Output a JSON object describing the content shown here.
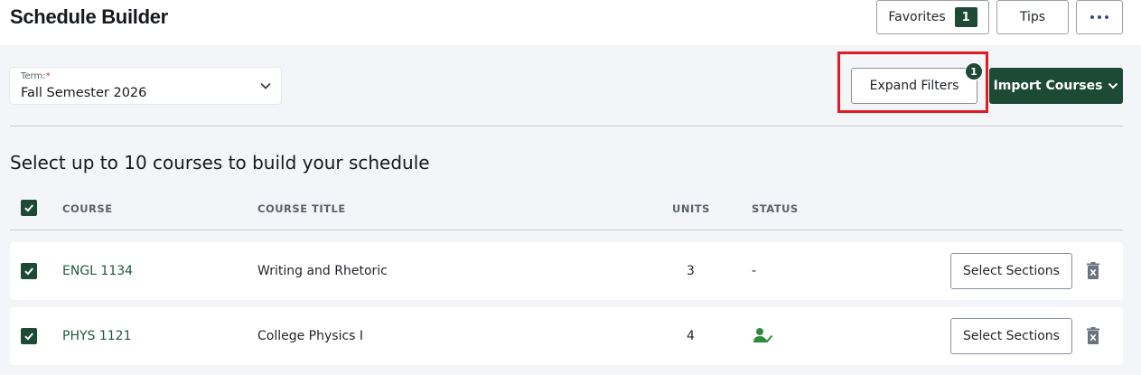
{
  "header": {
    "title": "Schedule Builder",
    "favorites_label": "Favorites",
    "favorites_count": "1",
    "tips_label": "Tips",
    "more_icon": "more-horizontal-icon"
  },
  "term": {
    "label": "Term:",
    "required_marker": "*",
    "value": "Fall Semester 2026"
  },
  "filters": {
    "expand_label": "Expand Filters",
    "active_count": "1",
    "import_label": "Import Courses"
  },
  "instructions": "Select up to 10 courses to build your schedule",
  "table": {
    "columns": [
      "COURSE",
      "COURSE TITLE",
      "UNITS",
      "STATUS"
    ],
    "rows": [
      {
        "checked": true,
        "course": "ENGL 1134",
        "title": "Writing and Rhetoric",
        "units": "3",
        "status": "-",
        "action": "Select Sections"
      },
      {
        "checked": true,
        "course": "PHYS 1121",
        "title": "College Physics I",
        "units": "4",
        "status_icon": "person-check-icon",
        "action": "Select Sections"
      }
    ]
  },
  "colors": {
    "brand_green": "#1d4a35",
    "highlight_red": "#e01b24",
    "status_green": "#2e8b3a"
  }
}
